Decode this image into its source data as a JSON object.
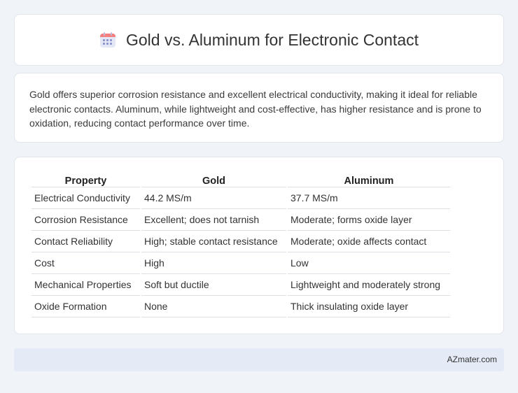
{
  "header": {
    "title": "Gold vs. Aluminum for Electronic Contact",
    "icon": "calendar-icon"
  },
  "description": {
    "text": "Gold offers superior corrosion resistance and excellent electrical conductivity, making it ideal for reliable electronic contacts. Aluminum, while lightweight and cost-effective, has higher resistance and is prone to oxidation, reducing contact performance over time."
  },
  "table": {
    "headers": [
      "Property",
      "Gold",
      "Aluminum"
    ],
    "rows": [
      [
        "Electrical Conductivity",
        "44.2 MS/m",
        "37.7 MS/m"
      ],
      [
        "Corrosion Resistance",
        "Excellent; does not tarnish",
        "Moderate; forms oxide layer"
      ],
      [
        "Contact Reliability",
        "High; stable contact resistance",
        "Moderate; oxide affects contact"
      ],
      [
        "Cost",
        "High",
        "Low"
      ],
      [
        "Mechanical Properties",
        "Soft but ductile",
        "Lightweight and moderately strong"
      ],
      [
        "Oxide Formation",
        "None",
        "Thick insulating oxide layer"
      ]
    ]
  },
  "footer": {
    "source": "AZmater.com"
  }
}
